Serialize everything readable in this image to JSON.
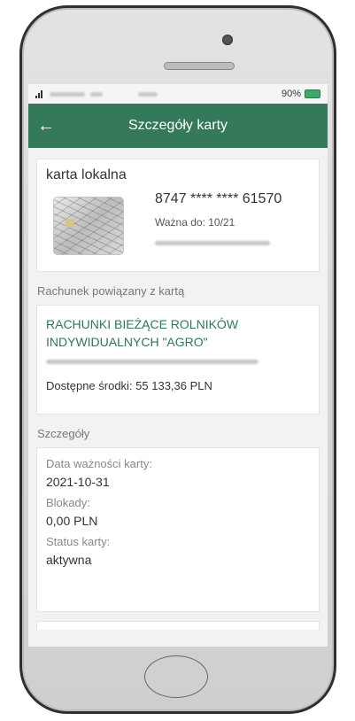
{
  "status": {
    "battery": "90%"
  },
  "header": {
    "back_icon": "←",
    "title": "Szczegóły karty"
  },
  "card": {
    "name": "karta lokalna",
    "number": "8747 **** **** 61570",
    "valid": "Ważna do: 10/21"
  },
  "linked_account": {
    "section_label": "Rachunek powiązany z kartą",
    "name_line1": "RACHUNKI BIEŻĄCE ROLNIKÓW",
    "name_line2": "INDYWIDUALNYCH \"AGRO\"",
    "available": "Dostępne środki: 55 133,36 PLN"
  },
  "details": {
    "section_label": "Szczegóły",
    "expiry_label": "Data ważności karty:",
    "expiry_value": "2021-10-31",
    "blocks_label": "Blokady:",
    "blocks_value": "0,00 PLN",
    "status_label": "Status karty:",
    "status_value": "aktywna"
  },
  "colors": {
    "header_bg": "#33795a",
    "accent_text": "#2d7a55"
  }
}
